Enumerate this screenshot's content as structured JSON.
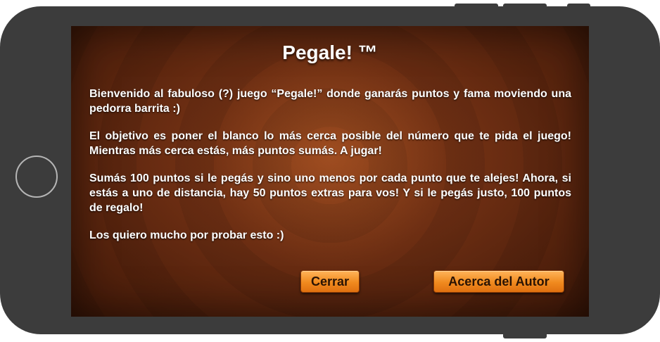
{
  "dialog": {
    "title": "Pegale! ™",
    "paragraphs": [
      "Bienvenido al fabuloso (?) juego “Pegale!” donde ganarás puntos y fama moviendo una pedorra barrita :)",
      "El objetivo es poner el blanco lo más cerca posible del número que te pida el juego! Mientras más cerca estás, más puntos sumás. A jugar!",
      "Sumás 100 puntos si le pegás y sino uno menos por cada punto que te alejes! Ahora, si estás a uno de distancia, hay 50 puntos extras para vos! Y si le pegás justo, 100 puntos de regalo!",
      "Los quiero mucho por probar esto :)"
    ],
    "buttons": {
      "close_label": "Cerrar",
      "about_label": "Acerca del Autor"
    }
  },
  "colors": {
    "device_body": "#3c3c3c",
    "screen_brown": "#6b2d12",
    "button_orange": "#f08a1e",
    "text": "#ffffff"
  }
}
